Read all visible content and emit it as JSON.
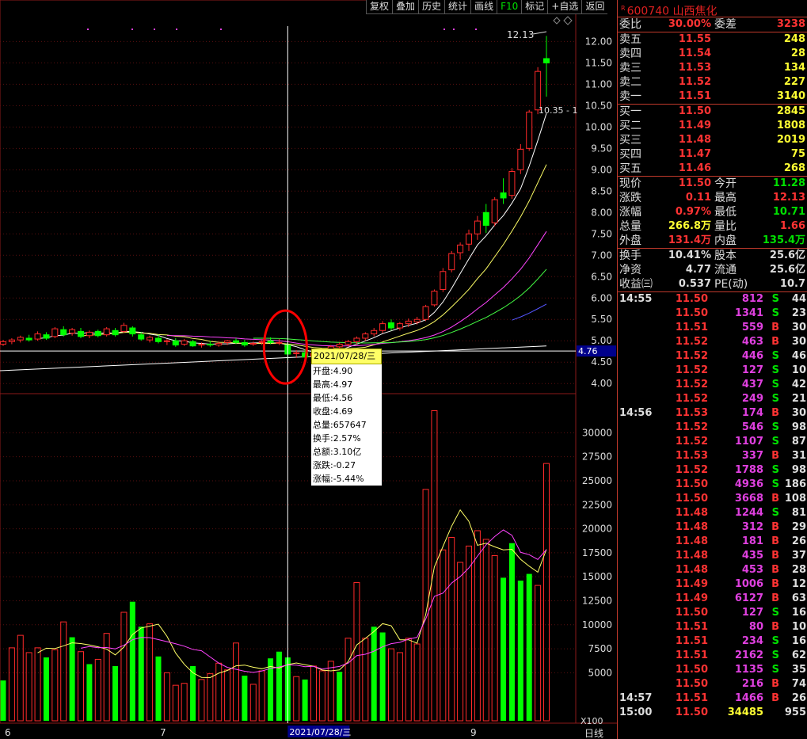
{
  "toolbar": [
    "复权",
    "叠加",
    "历史",
    "统计",
    "画线",
    "F10",
    "标记",
    "+自选",
    "返回"
  ],
  "stock": {
    "badge": "R",
    "code_name": "600740 山西焦化"
  },
  "quote": {
    "weibi": {
      "label": "委比",
      "value": "30.00%",
      "label2": "委差",
      "value2": "3238"
    },
    "sells": [
      {
        "label": "卖五",
        "price": "11.55",
        "vol": "248"
      },
      {
        "label": "卖四",
        "price": "11.54",
        "vol": "28"
      },
      {
        "label": "卖三",
        "price": "11.53",
        "vol": "134"
      },
      {
        "label": "卖二",
        "price": "11.52",
        "vol": "227"
      },
      {
        "label": "卖一",
        "price": "11.51",
        "vol": "3140"
      }
    ],
    "buys": [
      {
        "label": "买一",
        "price": "11.50",
        "vol": "2845"
      },
      {
        "label": "买二",
        "price": "11.49",
        "vol": "1808"
      },
      {
        "label": "买三",
        "price": "11.48",
        "vol": "2019"
      },
      {
        "label": "买四",
        "price": "11.47",
        "vol": "75"
      },
      {
        "label": "买五",
        "price": "11.46",
        "vol": "268"
      }
    ],
    "stats1": [
      {
        "l1": "现价",
        "v1": "11.50",
        "c1": "r",
        "l2": "今开",
        "v2": "11.28",
        "c2": "g"
      },
      {
        "l1": "涨跌",
        "v1": "0.11",
        "c1": "r",
        "l2": "最高",
        "v2": "12.13",
        "c2": "r"
      },
      {
        "l1": "涨幅",
        "v1": "0.97%",
        "c1": "r",
        "l2": "最低",
        "v2": "10.71",
        "c2": "g"
      },
      {
        "l1": "总量",
        "v1": "266.8万",
        "c1": "y",
        "l2": "量比",
        "v2": "1.66",
        "c2": "r"
      },
      {
        "l1": "外盘",
        "v1": "131.4万",
        "c1": "r",
        "l2": "内盘",
        "v2": "135.4万",
        "c2": "g"
      }
    ],
    "stats2": [
      {
        "l1": "换手",
        "v1": "10.41%",
        "c1": "w",
        "l2": "股本",
        "v2": "25.6亿",
        "c2": "w"
      },
      {
        "l1": "净资",
        "v1": "4.77",
        "c1": "w",
        "l2": "流通",
        "v2": "25.6亿",
        "c2": "w"
      },
      {
        "l1": "收益㈢",
        "v1": "0.537",
        "c1": "w",
        "l2": "PE(动)",
        "v2": "10.7",
        "c2": "w"
      }
    ]
  },
  "ticks": [
    {
      "time": "14:55",
      "price": "11.50",
      "vol": "812",
      "bs": "S",
      "n": "44"
    },
    {
      "time": "",
      "price": "11.50",
      "vol": "1341",
      "bs": "S",
      "n": "23"
    },
    {
      "time": "",
      "price": "11.51",
      "vol": "559",
      "bs": "B",
      "n": "30"
    },
    {
      "time": "",
      "price": "11.52",
      "vol": "463",
      "bs": "B",
      "n": "30"
    },
    {
      "time": "",
      "price": "11.52",
      "vol": "446",
      "bs": "S",
      "n": "46"
    },
    {
      "time": "",
      "price": "11.52",
      "vol": "127",
      "bs": "S",
      "n": "10"
    },
    {
      "time": "",
      "price": "11.52",
      "vol": "437",
      "bs": "S",
      "n": "42"
    },
    {
      "time": "",
      "price": "11.52",
      "vol": "249",
      "bs": "S",
      "n": "21"
    },
    {
      "time": "14:56",
      "price": "11.53",
      "vol": "174",
      "bs": "B",
      "n": "30"
    },
    {
      "time": "",
      "price": "11.52",
      "vol": "546",
      "bs": "S",
      "n": "98"
    },
    {
      "time": "",
      "price": "11.52",
      "vol": "1107",
      "bs": "S",
      "n": "87"
    },
    {
      "time": "",
      "price": "11.53",
      "vol": "337",
      "bs": "B",
      "n": "31"
    },
    {
      "time": "",
      "price": "11.52",
      "vol": "1788",
      "bs": "S",
      "n": "98"
    },
    {
      "time": "",
      "price": "11.50",
      "vol": "4936",
      "bs": "S",
      "n": "186"
    },
    {
      "time": "",
      "price": "11.50",
      "vol": "3668",
      "bs": "B",
      "n": "108"
    },
    {
      "time": "",
      "price": "11.48",
      "vol": "1244",
      "bs": "S",
      "n": "81"
    },
    {
      "time": "",
      "price": "11.48",
      "vol": "312",
      "bs": "B",
      "n": "29"
    },
    {
      "time": "",
      "price": "11.48",
      "vol": "181",
      "bs": "B",
      "n": "26"
    },
    {
      "time": "",
      "price": "11.48",
      "vol": "435",
      "bs": "B",
      "n": "37"
    },
    {
      "time": "",
      "price": "11.48",
      "vol": "453",
      "bs": "B",
      "n": "28"
    },
    {
      "time": "",
      "price": "11.49",
      "vol": "1006",
      "bs": "B",
      "n": "12"
    },
    {
      "time": "",
      "price": "11.49",
      "vol": "6127",
      "bs": "B",
      "n": "63"
    },
    {
      "time": "",
      "price": "11.50",
      "vol": "127",
      "bs": "S",
      "n": "16"
    },
    {
      "time": "",
      "price": "11.51",
      "vol": "80",
      "bs": "B",
      "n": "10"
    },
    {
      "time": "",
      "price": "11.51",
      "vol": "234",
      "bs": "S",
      "n": "16"
    },
    {
      "time": "",
      "price": "11.51",
      "vol": "2162",
      "bs": "S",
      "n": "62"
    },
    {
      "time": "",
      "price": "11.50",
      "vol": "1135",
      "bs": "S",
      "n": "35"
    },
    {
      "time": "",
      "price": "11.50",
      "vol": "216",
      "bs": "B",
      "n": "74"
    },
    {
      "time": "14:57",
      "price": "11.51",
      "vol": "1466",
      "bs": "B",
      "n": "26"
    },
    {
      "time": "15:00",
      "price": "11.50",
      "vol": "34485",
      "bs": "",
      "n": "955"
    }
  ],
  "tooltip": {
    "date": "2021/07/28/三",
    "lines": [
      "开盘:4.90",
      "最高:4.97",
      "最低:4.56",
      "收盘:4.69",
      "总量:657647",
      "换手:2.57%",
      "总额:3.10亿",
      "涨跌:-0.27",
      "涨幅:-5.44%"
    ]
  },
  "chart_data": {
    "type": "candlestick",
    "price_ticks": [
      "12.00",
      "11.50",
      "11.00",
      "10.50",
      "10.00",
      "9.50",
      "9.00",
      "8.50",
      "8.00",
      "7.50",
      "7.00",
      "6.50",
      "6.00",
      "5.50",
      "5.00",
      "4.50",
      "4.00"
    ],
    "price_range": [
      3.8,
      12.6
    ],
    "last_price_marker": "4.76",
    "high_label": "12.13",
    "low_label": "10.35",
    "volume_ticks": [
      "30000",
      "27500",
      "25000",
      "22500",
      "20000",
      "17500",
      "15000",
      "12500",
      "10000",
      "7500",
      "5000"
    ],
    "volume_range": [
      0,
      33000
    ],
    "volume_unit_label": "X100",
    "x_labels": [
      {
        "text": "6",
        "i": 0
      },
      {
        "text": "7",
        "i": 18
      },
      {
        "text": "9",
        "i": 54
      }
    ],
    "cursor_date": "2021/07/28/三",
    "cursor_index": 33,
    "period_label": "日线",
    "candles": [
      {
        "o": 4.92,
        "h": 5.02,
        "l": 4.88,
        "c": 4.98
      },
      {
        "o": 4.98,
        "h": 5.06,
        "l": 4.92,
        "c": 5.02
      },
      {
        "o": 5.02,
        "h": 5.12,
        "l": 4.96,
        "c": 5.08
      },
      {
        "o": 5.06,
        "h": 5.14,
        "l": 4.98,
        "c": 5.02
      },
      {
        "o": 5.04,
        "h": 5.22,
        "l": 5.0,
        "c": 5.16
      },
      {
        "o": 5.14,
        "h": 5.2,
        "l": 5.02,
        "c": 5.06
      },
      {
        "o": 5.1,
        "h": 5.32,
        "l": 5.06,
        "c": 5.28
      },
      {
        "o": 5.26,
        "h": 5.34,
        "l": 5.1,
        "c": 5.14
      },
      {
        "o": 5.18,
        "h": 5.3,
        "l": 5.12,
        "c": 5.26
      },
      {
        "o": 5.22,
        "h": 5.3,
        "l": 5.06,
        "c": 5.1
      },
      {
        "o": 5.12,
        "h": 5.24,
        "l": 5.06,
        "c": 5.2
      },
      {
        "o": 5.22,
        "h": 5.26,
        "l": 5.08,
        "c": 5.12
      },
      {
        "o": 5.14,
        "h": 5.32,
        "l": 5.1,
        "c": 5.28
      },
      {
        "o": 5.24,
        "h": 5.3,
        "l": 5.1,
        "c": 5.14
      },
      {
        "o": 5.22,
        "h": 5.42,
        "l": 5.18,
        "c": 5.36
      },
      {
        "o": 5.3,
        "h": 5.34,
        "l": 5.1,
        "c": 5.16
      },
      {
        "o": 5.14,
        "h": 5.2,
        "l": 5.0,
        "c": 5.04
      },
      {
        "o": 5.02,
        "h": 5.12,
        "l": 4.96,
        "c": 5.08
      },
      {
        "o": 5.06,
        "h": 5.14,
        "l": 4.94,
        "c": 4.98
      },
      {
        "o": 4.98,
        "h": 5.04,
        "l": 4.9,
        "c": 5.0
      },
      {
        "o": 5.0,
        "h": 5.06,
        "l": 4.86,
        "c": 4.9
      },
      {
        "o": 4.92,
        "h": 5.04,
        "l": 4.88,
        "c": 5.0
      },
      {
        "o": 4.98,
        "h": 5.02,
        "l": 4.86,
        "c": 4.88
      },
      {
        "o": 4.9,
        "h": 4.96,
        "l": 4.84,
        "c": 4.92
      },
      {
        "o": 4.92,
        "h": 5.0,
        "l": 4.86,
        "c": 4.9
      },
      {
        "o": 4.9,
        "h": 4.98,
        "l": 4.86,
        "c": 4.94
      },
      {
        "o": 4.96,
        "h": 5.02,
        "l": 4.9,
        "c": 5.0
      },
      {
        "o": 5.0,
        "h": 5.06,
        "l": 4.92,
        "c": 4.96
      },
      {
        "o": 4.96,
        "h": 5.02,
        "l": 4.86,
        "c": 4.9
      },
      {
        "o": 4.92,
        "h": 4.98,
        "l": 4.88,
        "c": 4.94
      },
      {
        "o": 4.96,
        "h": 5.04,
        "l": 4.9,
        "c": 4.98
      },
      {
        "o": 5.0,
        "h": 5.08,
        "l": 4.92,
        "c": 4.96
      },
      {
        "o": 4.96,
        "h": 5.04,
        "l": 4.9,
        "c": 4.96
      },
      {
        "o": 4.9,
        "h": 4.97,
        "l": 4.56,
        "c": 4.69
      },
      {
        "o": 4.7,
        "h": 4.78,
        "l": 4.6,
        "c": 4.72
      },
      {
        "o": 4.72,
        "h": 4.8,
        "l": 4.58,
        "c": 4.62
      },
      {
        "o": 4.64,
        "h": 4.74,
        "l": 4.58,
        "c": 4.7
      },
      {
        "o": 4.7,
        "h": 4.82,
        "l": 4.66,
        "c": 4.78
      },
      {
        "o": 4.78,
        "h": 4.9,
        "l": 4.72,
        "c": 4.86
      },
      {
        "o": 4.86,
        "h": 4.96,
        "l": 4.8,
        "c": 4.92
      },
      {
        "o": 4.92,
        "h": 5.02,
        "l": 4.86,
        "c": 4.98
      },
      {
        "o": 4.98,
        "h": 5.1,
        "l": 4.92,
        "c": 5.06
      },
      {
        "o": 5.06,
        "h": 5.2,
        "l": 5.0,
        "c": 5.16
      },
      {
        "o": 5.16,
        "h": 5.3,
        "l": 5.1,
        "c": 5.24
      },
      {
        "o": 5.24,
        "h": 5.46,
        "l": 5.18,
        "c": 5.4
      },
      {
        "o": 5.42,
        "h": 5.5,
        "l": 5.24,
        "c": 5.3
      },
      {
        "o": 5.3,
        "h": 5.44,
        "l": 5.24,
        "c": 5.4
      },
      {
        "o": 5.4,
        "h": 5.52,
        "l": 5.32,
        "c": 5.46
      },
      {
        "o": 5.44,
        "h": 5.56,
        "l": 5.38,
        "c": 5.5
      },
      {
        "o": 5.5,
        "h": 5.84,
        "l": 5.46,
        "c": 5.8
      },
      {
        "o": 5.84,
        "h": 6.2,
        "l": 5.8,
        "c": 6.16
      },
      {
        "o": 6.2,
        "h": 6.7,
        "l": 6.14,
        "c": 6.62
      },
      {
        "o": 6.66,
        "h": 7.1,
        "l": 6.6,
        "c": 7.04
      },
      {
        "o": 7.06,
        "h": 7.3,
        "l": 6.9,
        "c": 7.24
      },
      {
        "o": 7.26,
        "h": 7.6,
        "l": 7.1,
        "c": 7.5
      },
      {
        "o": 7.5,
        "h": 7.92,
        "l": 7.36,
        "c": 7.8
      },
      {
        "o": 8.0,
        "h": 8.2,
        "l": 7.52,
        "c": 7.7
      },
      {
        "o": 7.76,
        "h": 8.36,
        "l": 7.68,
        "c": 8.3
      },
      {
        "o": 8.46,
        "h": 8.8,
        "l": 8.2,
        "c": 8.34
      },
      {
        "o": 8.4,
        "h": 9.04,
        "l": 8.32,
        "c": 8.96
      },
      {
        "o": 9.0,
        "h": 9.6,
        "l": 8.9,
        "c": 9.48
      },
      {
        "o": 9.5,
        "h": 10.4,
        "l": 9.44,
        "c": 10.35
      },
      {
        "o": 10.4,
        "h": 11.4,
        "l": 10.3,
        "c": 11.3
      },
      {
        "o": 11.6,
        "h": 12.13,
        "l": 10.71,
        "c": 11.5
      }
    ],
    "volumes": [
      {
        "v": 4200,
        "up": false
      },
      {
        "v": 7600,
        "up": true
      },
      {
        "v": 8900,
        "up": true
      },
      {
        "v": 7100,
        "up": true
      },
      {
        "v": 7600,
        "up": true
      },
      {
        "v": 6600,
        "up": false
      },
      {
        "v": 7400,
        "up": true
      },
      {
        "v": 10300,
        "up": true
      },
      {
        "v": 8700,
        "up": false
      },
      {
        "v": 7200,
        "up": true
      },
      {
        "v": 5900,
        "up": false
      },
      {
        "v": 6400,
        "up": true
      },
      {
        "v": 9100,
        "up": true
      },
      {
        "v": 5700,
        "up": false
      },
      {
        "v": 11300,
        "up": true
      },
      {
        "v": 12400,
        "up": false
      },
      {
        "v": 9800,
        "up": false
      },
      {
        "v": 10100,
        "up": true
      },
      {
        "v": 6700,
        "up": false
      },
      {
        "v": 5000,
        "up": true
      },
      {
        "v": 3700,
        "up": true
      },
      {
        "v": 3900,
        "up": true
      },
      {
        "v": 5700,
        "up": false
      },
      {
        "v": 4300,
        "up": true
      },
      {
        "v": 4900,
        "up": true
      },
      {
        "v": 6000,
        "up": true
      },
      {
        "v": 5300,
        "up": true
      },
      {
        "v": 8100,
        "up": true
      },
      {
        "v": 4700,
        "up": false
      },
      {
        "v": 3800,
        "up": true
      },
      {
        "v": 5200,
        "up": true
      },
      {
        "v": 6500,
        "up": false
      },
      {
        "v": 7200,
        "up": false
      },
      {
        "v": 6600,
        "up": false
      },
      {
        "v": 4600,
        "up": true
      },
      {
        "v": 4300,
        "up": false
      },
      {
        "v": 5700,
        "up": true
      },
      {
        "v": 5200,
        "up": true
      },
      {
        "v": 6200,
        "up": true
      },
      {
        "v": 5100,
        "up": false
      },
      {
        "v": 8600,
        "up": true
      },
      {
        "v": 14400,
        "up": true
      },
      {
        "v": 8600,
        "up": true
      },
      {
        "v": 9800,
        "up": false
      },
      {
        "v": 9200,
        "up": false
      },
      {
        "v": 7500,
        "up": true
      },
      {
        "v": 7100,
        "up": true
      },
      {
        "v": 8600,
        "up": true
      },
      {
        "v": 8000,
        "up": true
      },
      {
        "v": 24100,
        "up": true
      },
      {
        "v": 32300,
        "up": true
      },
      {
        "v": 17800,
        "up": true
      },
      {
        "v": 19100,
        "up": true
      },
      {
        "v": 16500,
        "up": true
      },
      {
        "v": 18200,
        "up": true
      },
      {
        "v": 19800,
        "up": true
      },
      {
        "v": 18900,
        "up": true
      },
      {
        "v": 17200,
        "up": true
      },
      {
        "v": 14900,
        "up": false
      },
      {
        "v": 18500,
        "up": false
      },
      {
        "v": 14600,
        "up": false
      },
      {
        "v": 15300,
        "up": false
      },
      {
        "v": 14100,
        "up": true
      },
      {
        "v": 26800,
        "up": true
      }
    ]
  }
}
